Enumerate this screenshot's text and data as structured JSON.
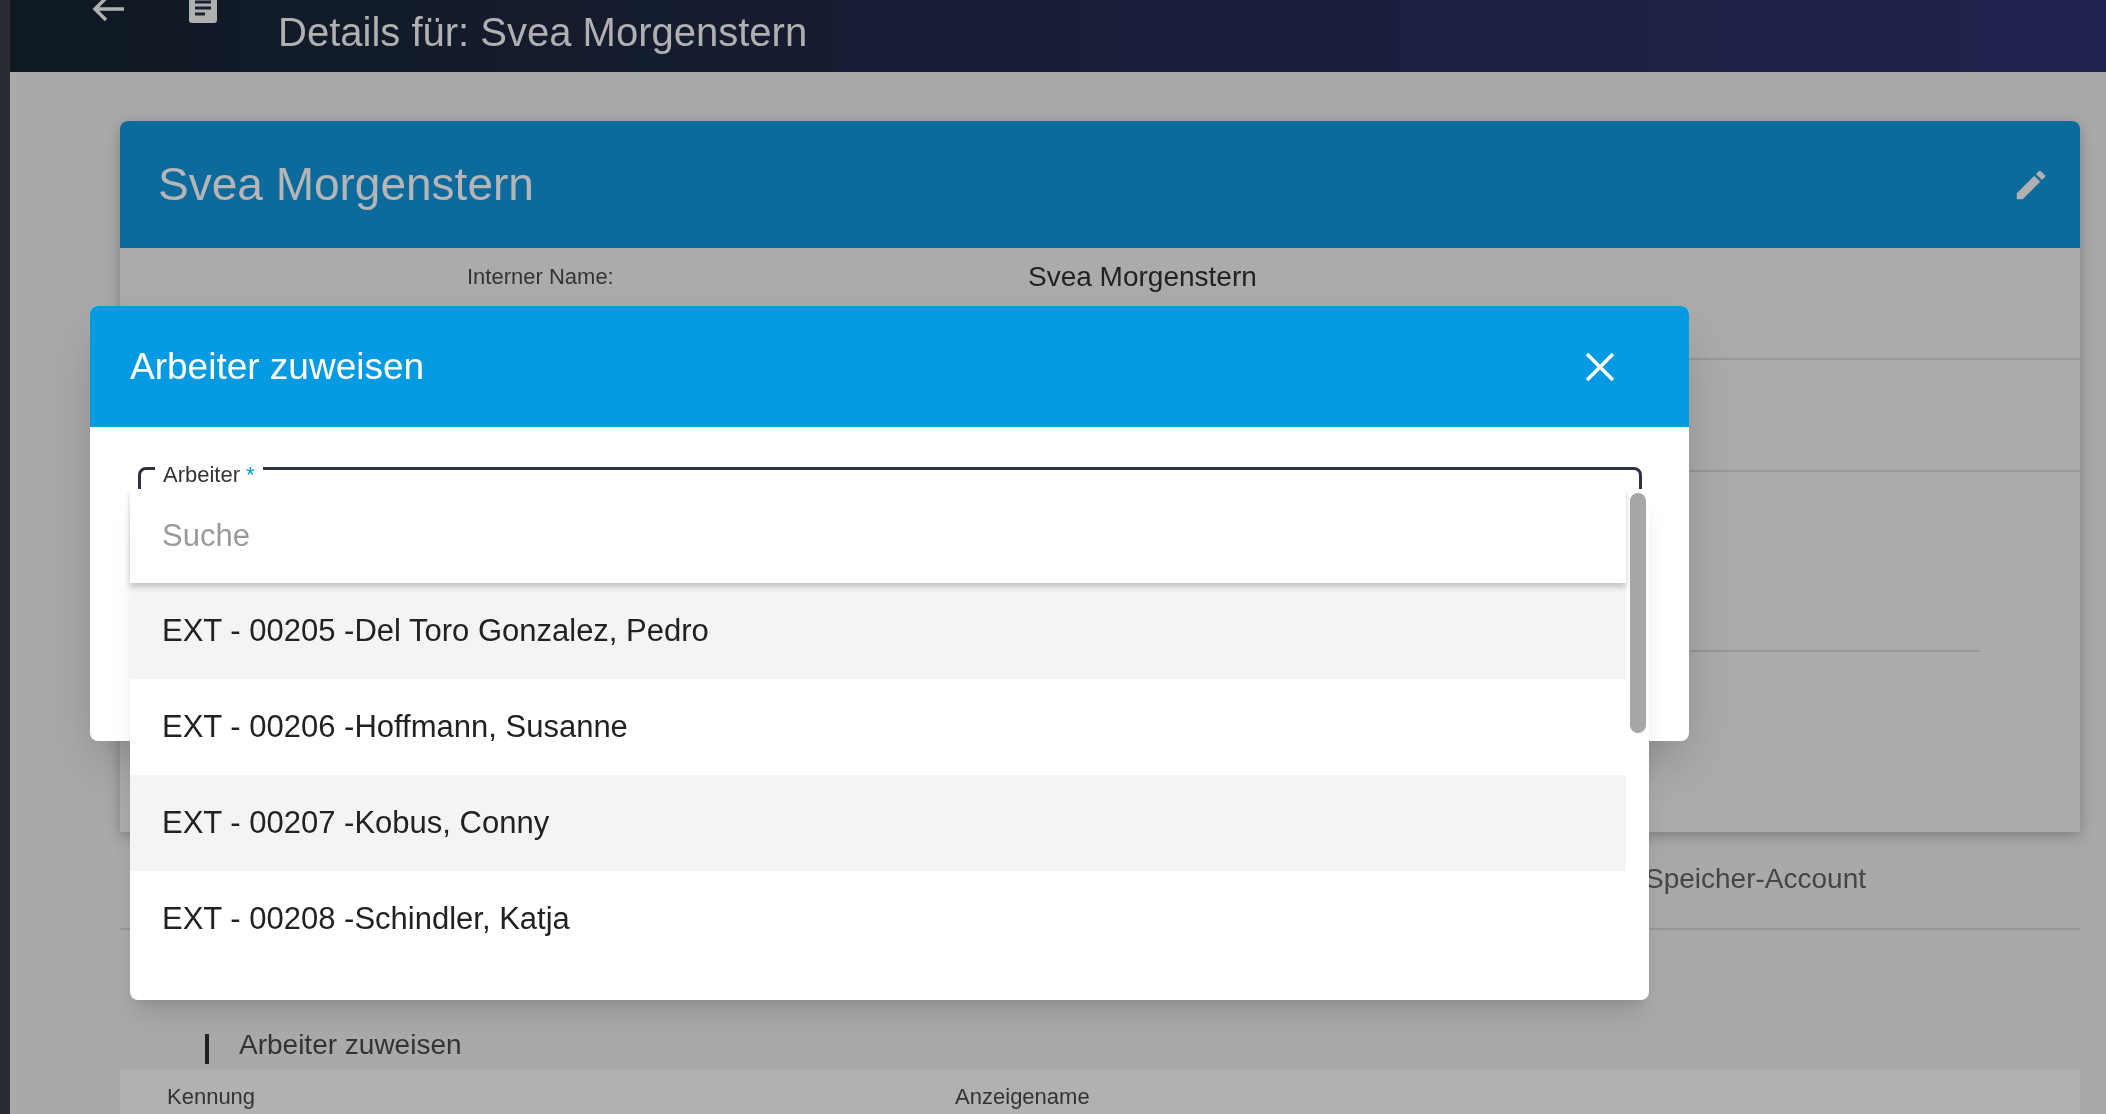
{
  "top_bar": {
    "title": "Details für: Svea Morgenstern"
  },
  "card": {
    "title": "Svea Morgenstern",
    "fields": [
      {
        "label": "Interner Name:",
        "value": "Svea Morgenstern"
      }
    ]
  },
  "account_label": "Speicher-Account",
  "assign_link": "Arbeiter zuweisen",
  "table": {
    "columns": [
      "Kennung",
      "Anzeigename"
    ]
  },
  "dialog": {
    "title": "Arbeiter zuweisen",
    "field": {
      "label": "Arbeiter",
      "required": true,
      "required_mark": "*"
    },
    "search": {
      "placeholder": "Suche"
    },
    "options": [
      {
        "label": "EXT - 00205 -Del Toro Gonzalez, Pedro"
      },
      {
        "label": "EXT - 00206 -Hoffmann, Susanne"
      },
      {
        "label": "EXT - 00207 -Kobus, Conny"
      },
      {
        "label": "EXT - 00208 -Schindler, Katja"
      }
    ]
  }
}
